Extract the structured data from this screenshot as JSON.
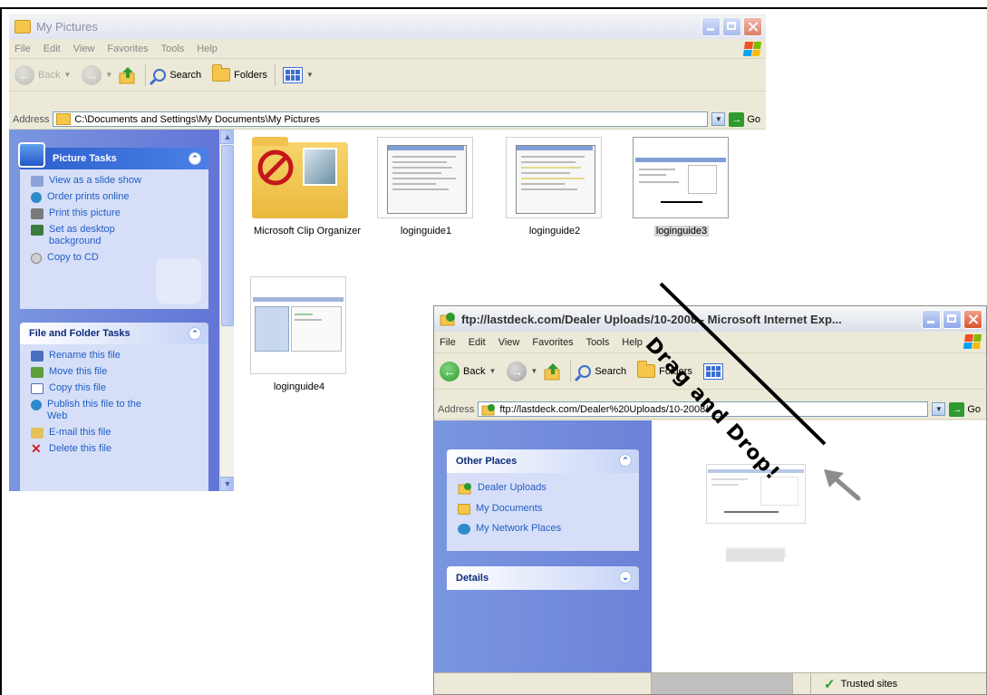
{
  "my_pictures": {
    "title": "My Pictures",
    "menu": [
      "File",
      "Edit",
      "View",
      "Favorites",
      "Tools",
      "Help"
    ],
    "toolbar": {
      "back": "Back",
      "search": "Search",
      "folders": "Folders"
    },
    "address": {
      "label": "Address",
      "value": "C:\\Documents and Settings\\My Documents\\My Pictures",
      "go": "Go"
    },
    "picture_tasks": {
      "title": "Picture Tasks",
      "items": [
        "View as a slide show",
        "Order prints online",
        "Print this picture",
        "Set as desktop background",
        "Copy to CD"
      ]
    },
    "file_folder_tasks": {
      "title": "File and Folder Tasks",
      "items": [
        "Rename this file",
        "Move this file",
        "Copy this file",
        "Publish this file to the Web",
        "E-mail this file",
        "Delete this file"
      ]
    },
    "files": [
      "Microsoft Clip Organizer",
      "loginguide1",
      "loginguide2",
      "loginguide3",
      "loginguide4"
    ]
  },
  "ftp_window": {
    "title": "ftp://lastdeck.com/Dealer Uploads/10-2008 - Microsoft Internet Exp...",
    "menu": [
      "File",
      "Edit",
      "View",
      "Favorites",
      "Tools",
      "Help"
    ],
    "toolbar": {
      "back": "Back",
      "search": "Search",
      "folders": "Folders"
    },
    "address": {
      "label": "Address",
      "value": "ftp://lastdeck.com/Dealer%20Uploads/10-2008/",
      "go": "Go"
    },
    "other_places": {
      "title": "Other Places",
      "items": [
        "Dealer Uploads",
        "My Documents",
        "My Network Places"
      ]
    },
    "details": {
      "title": "Details"
    },
    "status": {
      "zone": "Trusted sites"
    }
  },
  "annotation": {
    "text": "Drag and Drop!"
  },
  "colors": {
    "xp_blue": "#215dc6",
    "task_pane": "#6d83d9",
    "window_chrome": "#ece9d8"
  }
}
